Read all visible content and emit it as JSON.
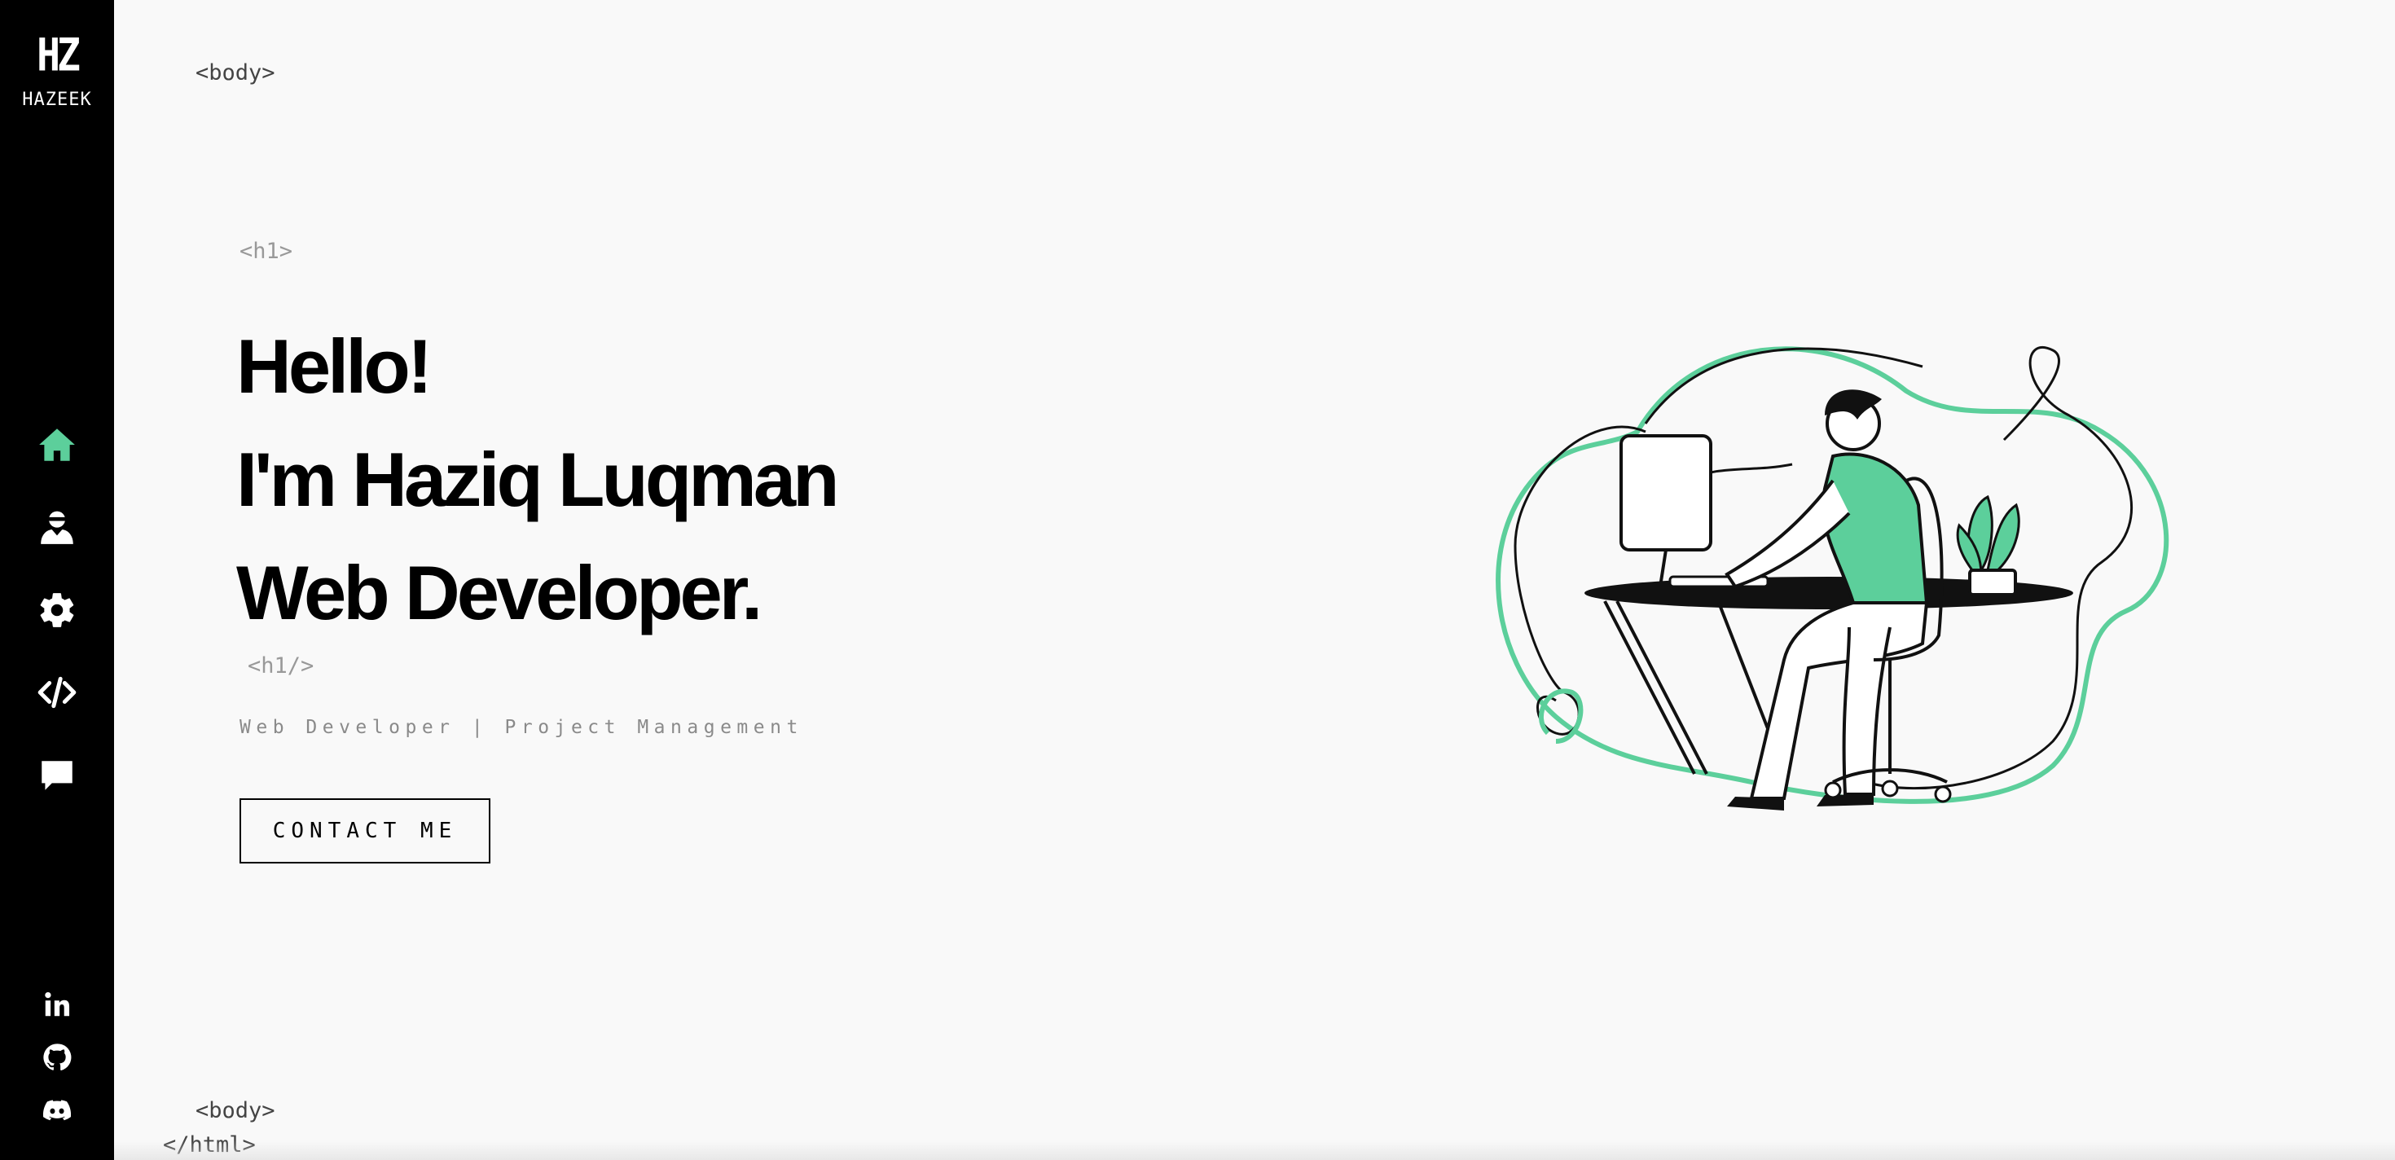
{
  "sidebar": {
    "logo_mark": "HZ",
    "logo_text": "HAZEEK",
    "nav": [
      {
        "name": "home",
        "icon": "home-icon",
        "active": true
      },
      {
        "name": "about",
        "icon": "user-icon",
        "active": false
      },
      {
        "name": "skills",
        "icon": "gear-icon",
        "active": false
      },
      {
        "name": "projects",
        "icon": "code-icon",
        "active": false
      },
      {
        "name": "contact",
        "icon": "chat-icon",
        "active": false
      }
    ],
    "social": [
      {
        "name": "linkedin",
        "icon": "linkedin-icon"
      },
      {
        "name": "github",
        "icon": "github-icon"
      },
      {
        "name": "discord",
        "icon": "discord-icon"
      }
    ]
  },
  "tags": {
    "body_open": "<body>",
    "h1_open": "<h1>",
    "h1_close": "<h1/>",
    "body_close": "<body>",
    "html_close": "</html>"
  },
  "hero": {
    "line1": "Hello!",
    "line2": "I'm Haziq Luqman",
    "line3": "Web Developer.",
    "subtitle": "Web Developer | Project Management",
    "cta_label": "CONTACT ME"
  },
  "colors": {
    "accent": "#5ccf9b",
    "sidebar_bg": "#000000",
    "page_bg": "#f9f9f9",
    "text": "#000000"
  }
}
